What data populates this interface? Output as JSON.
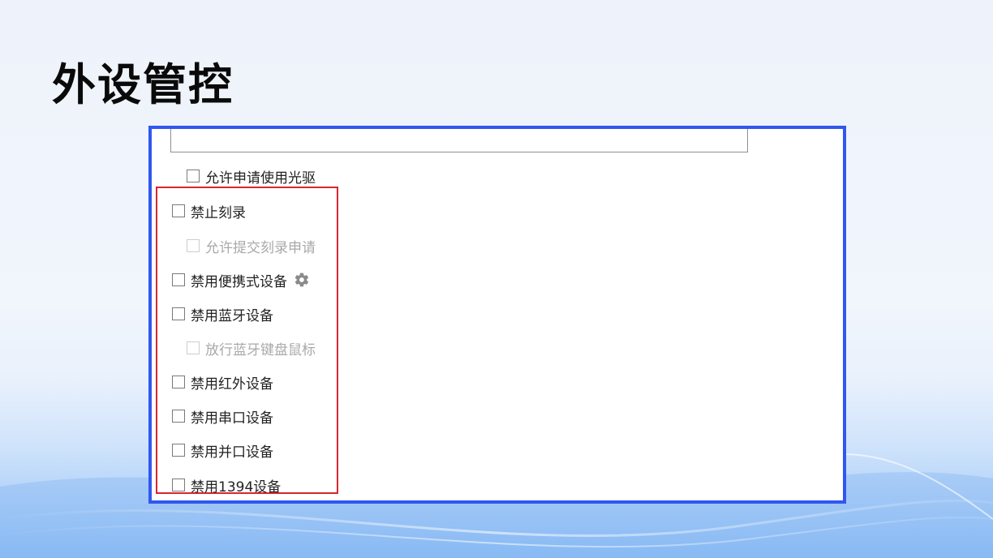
{
  "slide": {
    "title": "外设管控"
  },
  "panel": {
    "top_option": {
      "label": "允许申请使用光驱",
      "checked": false,
      "disabled": false
    },
    "options": [
      {
        "label": "禁止刻录",
        "checked": false,
        "disabled": false
      },
      {
        "label": "允许提交刻录申请",
        "checked": false,
        "disabled": true
      },
      {
        "label": "禁用便携式设备",
        "checked": false,
        "disabled": false,
        "icon": "gear-icon"
      },
      {
        "label": "禁用蓝牙设备",
        "checked": false,
        "disabled": false
      },
      {
        "label": "放行蓝牙键盘鼠标",
        "checked": false,
        "disabled": true
      },
      {
        "label": "禁用红外设备",
        "checked": false,
        "disabled": false
      },
      {
        "label": "禁用串口设备",
        "checked": false,
        "disabled": false
      },
      {
        "label": "禁用并口设备",
        "checked": false,
        "disabled": false
      },
      {
        "label": "禁用1394设备",
        "checked": false,
        "disabled": false
      }
    ]
  },
  "colors": {
    "frame_border": "#3157f0",
    "highlight_border": "#d9262c"
  }
}
